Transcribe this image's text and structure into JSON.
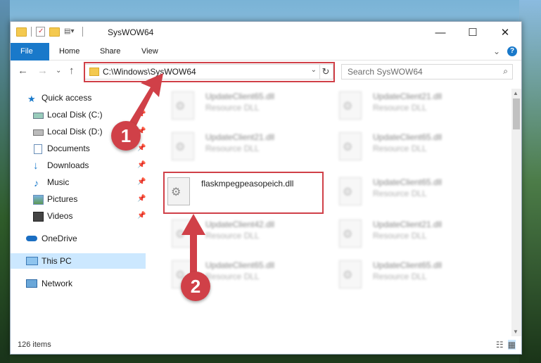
{
  "window": {
    "title": "SysWOW64",
    "controls": {
      "minimize": "—",
      "maximize": "☐",
      "close": "✕"
    }
  },
  "ribbon": {
    "tabs": [
      "File",
      "Home",
      "Share",
      "View"
    ],
    "expand": "⌄",
    "help": "?"
  },
  "address": {
    "path": "C:\\Windows\\SysWOW64",
    "dropdown": "⌄",
    "refresh": "↻"
  },
  "search": {
    "placeholder": "Search SysWOW64",
    "icon": "⌕"
  },
  "nav": {
    "back": "←",
    "forward": "→",
    "recent": "⌄",
    "up": "↑"
  },
  "sidebar": {
    "items": [
      {
        "label": "Quick access",
        "icon": "star-icon",
        "pinned": false
      },
      {
        "label": "Local Disk (C:)",
        "icon": "drive-icon",
        "pinned": true
      },
      {
        "label": "Local Disk (D:)",
        "icon": "drive-icon",
        "pinned": true
      },
      {
        "label": "Documents",
        "icon": "documents-icon",
        "pinned": true
      },
      {
        "label": "Downloads",
        "icon": "download-icon",
        "pinned": true
      },
      {
        "label": "Music",
        "icon": "music-icon",
        "pinned": true
      },
      {
        "label": "Pictures",
        "icon": "pictures-icon",
        "pinned": true
      },
      {
        "label": "Videos",
        "icon": "videos-icon",
        "pinned": true
      },
      {
        "label": "OneDrive",
        "icon": "cloud-icon",
        "pinned": false
      },
      {
        "label": "This PC",
        "icon": "computer-icon",
        "pinned": false
      },
      {
        "label": "Network",
        "icon": "network-icon",
        "pinned": false
      }
    ]
  },
  "files": {
    "left": [
      {
        "name": "UpdateClient65.dll",
        "type": "Resource DLL"
      },
      {
        "name": "UpdateClient21.dll",
        "type": "Resource DLL"
      },
      {
        "name": "flaskmpegpeasopeich.dll",
        "type": ""
      },
      {
        "name": "UpdateClient42.dll",
        "type": "Resource DLL"
      },
      {
        "name": "UpdateClient65.dll",
        "type": "Resource DLL"
      }
    ],
    "right": [
      {
        "name": "UpdateClient21.dll",
        "type": "Resource DLL"
      },
      {
        "name": "UpdateClient65.dll",
        "type": "Resource DLL"
      },
      {
        "name": "UpdateClient65.dll",
        "type": "Resource DLL"
      },
      {
        "name": "UpdateClient21.dll",
        "type": "Resource DLL"
      },
      {
        "name": "UpdateClient65.dll",
        "type": "Resource DLL"
      }
    ]
  },
  "status": {
    "count": "126 items"
  },
  "annotations": {
    "step1": "1",
    "step2": "2",
    "color": "#d04048"
  },
  "colors": {
    "accent": "#1979ca",
    "selection": "#cce8ff",
    "highlight": "#d04048"
  }
}
